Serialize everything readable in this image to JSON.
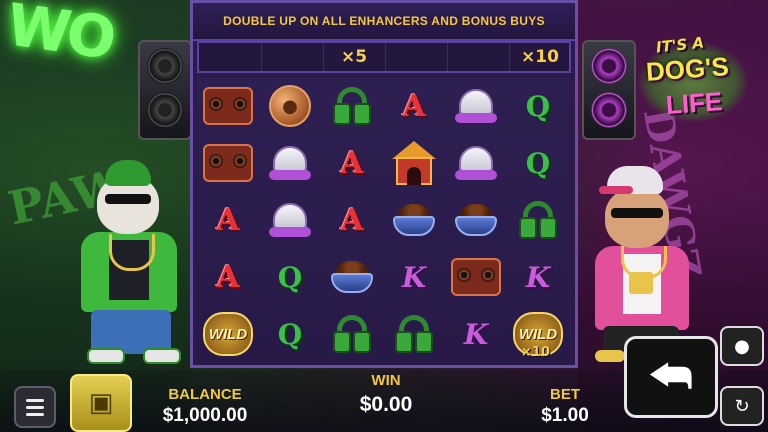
{
  "banner": {
    "text": "DOUBLE UP ON ALL ENHANCERS AND BONUS BUYS"
  },
  "multipliers": {
    "reel3": "×5",
    "reel6": "×10"
  },
  "reels": [
    [
      "boombox",
      "boombox",
      "A",
      "A",
      "WILD"
    ],
    [
      "paw-coin",
      "cap",
      "cap",
      "Q",
      "Q"
    ],
    [
      "headphones",
      "A",
      "A",
      "bowl",
      "headphones"
    ],
    [
      "A",
      "doghouse",
      "bowl",
      "K",
      "headphones"
    ],
    [
      "cap",
      "cap",
      "bowl",
      "boombox",
      "K"
    ],
    [
      "Q",
      "Q",
      "headphones",
      "K",
      "WILD"
    ]
  ],
  "wild_multiplier": "×10",
  "wild_label": "WILD",
  "logo": {
    "line1": "IT'S A",
    "line2": "DOG'S",
    "line3": "LIFE"
  },
  "scenery": {
    "neon": "WO",
    "graffiti_left": "PAW",
    "graffiti_right": "DAWGZ"
  },
  "footer": {
    "balance_label": "BALANCE",
    "balance_value": "$1,000.00",
    "win_label": "WIN",
    "win_value": "$0.00",
    "bet_label": "BET",
    "bet_value": "$1.00"
  },
  "colors": {
    "accent_gold": "#f0c93c",
    "frame_purple": "#6a4fa6"
  }
}
